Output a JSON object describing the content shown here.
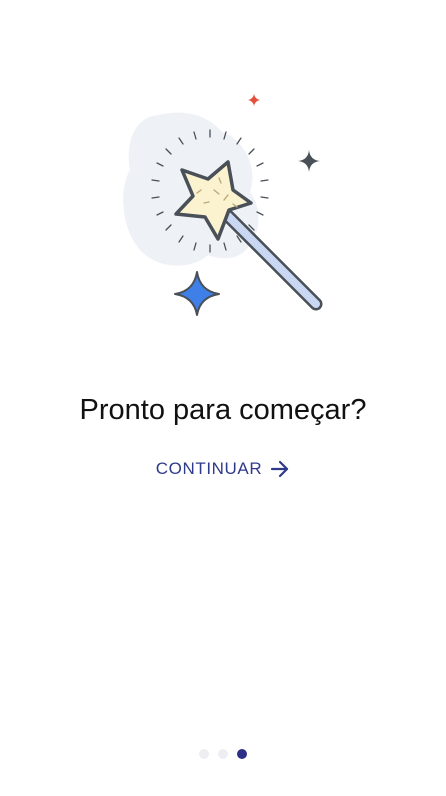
{
  "onboarding": {
    "title": "Pronto para começar?",
    "continue_label": "CONTINUAR",
    "illustration_icon": "magic-wand-icon",
    "arrow_icon": "arrow-right-icon"
  },
  "pagination": {
    "total": 3,
    "current": 3
  },
  "colors": {
    "accent": "#2f3a8a",
    "active_dot": "#2d2f84",
    "inactive_dot": "#eeeef2",
    "star_blue": "#3f7fe8",
    "star_fill": "#fbf3cf",
    "sparkle_red": "#e4503c"
  }
}
